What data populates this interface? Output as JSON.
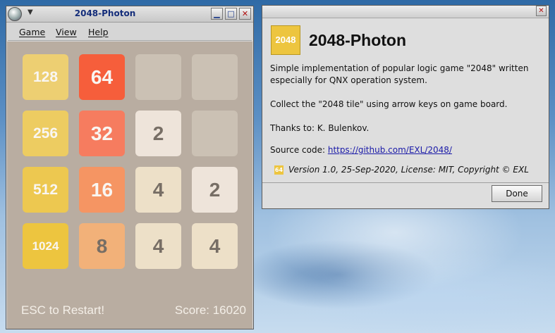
{
  "game_window": {
    "title": "2048-Photon",
    "controls": {
      "minimize": "▁",
      "maximize": "□",
      "close": "✕"
    },
    "menu": [
      "Game",
      "View",
      "Help"
    ],
    "tiles": [
      [
        "128",
        "64",
        "",
        ""
      ],
      [
        "256",
        "32",
        "2",
        ""
      ],
      [
        "512",
        "16",
        "4",
        "2"
      ],
      [
        "1024",
        "8",
        "4",
        "4"
      ]
    ],
    "restart_hint": "ESC to Restart!",
    "score": "Score: 16020"
  },
  "about_window": {
    "close": "✕",
    "logo_text": "2048",
    "title": "2048-Photon",
    "description_line1": "Simple implementation of popular logic game \"2048\" written",
    "description_line2": "especially for QNX operation system.",
    "instruction": "Collect the \"2048 tile\" using arrow keys on game board.",
    "thanks": "Thanks to: K. Bulenkov.",
    "source_label": "Source code:",
    "source_link": "https://github.com/EXL/2048/",
    "version_icon": "64",
    "version": "Version 1.0, 25-Sep-2020, License: MIT, Copyright © EXL",
    "done_label": "Done"
  },
  "colors": {
    "board": "#b9ada1",
    "empty": "#cbc1b4",
    "2": "#eee4da",
    "4": "#ede0c8",
    "8": "#f2b179",
    "16": "#f59563",
    "32": "#f67c5f",
    "64": "#f65e3b",
    "128": "#edcf72",
    "256": "#edcc61",
    "512": "#edc850",
    "1024": "#edc53f"
  }
}
